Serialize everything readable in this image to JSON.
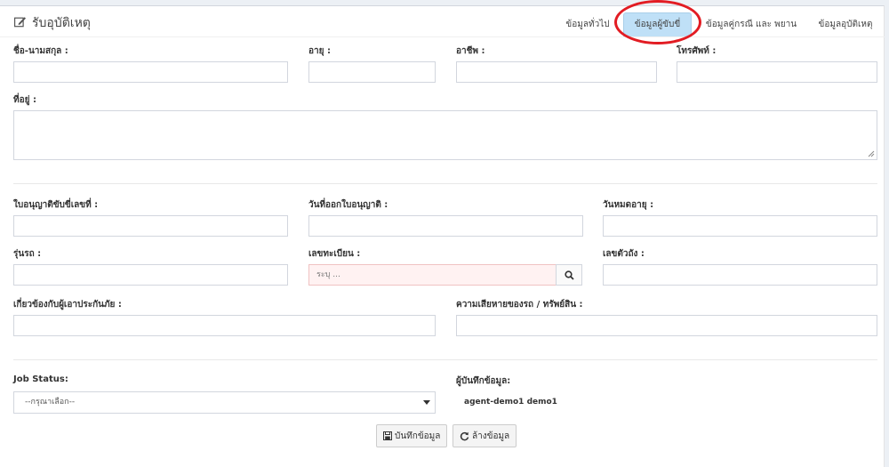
{
  "header": {
    "title": "รับอุบัติเหตุ",
    "tabs": [
      {
        "label": "ข้อมูลทั่วไป",
        "active": false
      },
      {
        "label": "ข้อมูลผู้ขับขี่",
        "active": true
      },
      {
        "label": "ข้อมูลคู่กรณี และ พยาน",
        "active": false
      },
      {
        "label": "ข้อมูลอุบัติเหตุ",
        "active": false
      }
    ]
  },
  "form": {
    "name_label": "ชื่อ-นามสกุล :",
    "age_label": "อายุ :",
    "occupation_label": "อาชีพ :",
    "phone_label": "โทรศัพท์ :",
    "address_label": "ที่อยู่ :",
    "license_no_label": "ใบอนุญาติขับขี่เลขที่ :",
    "license_issue_label": "วันที่ออกใบอนุญาติ :",
    "license_expire_label": "วันหมดอายุ :",
    "model_label": "รุ่นรถ :",
    "plate_label": "เลขทะเบียน :",
    "plate_placeholder": "ระบุ ...",
    "chassis_label": "เลขตัวถัง :",
    "relation_label": "เกี่ยวข้องกับผู้เอาประกันภัย :",
    "damage_label": "ความเสียหายของรถ / ทรัพย์สิน :",
    "job_status_label": "Job Status:",
    "job_status_value": "--กรุณาเลือก--",
    "recorder_label": "ผู้บันทึกข้อมูล:",
    "recorder_value": "agent-demo1 demo1"
  },
  "actions": {
    "save_label": "บันทึกข้อมูล",
    "clear_label": "ล้างข้อมูล"
  },
  "colors": {
    "active_tab": "#bfe0f7",
    "highlight_circle": "#e21c23",
    "required_input_bg": "#fff2f2"
  }
}
